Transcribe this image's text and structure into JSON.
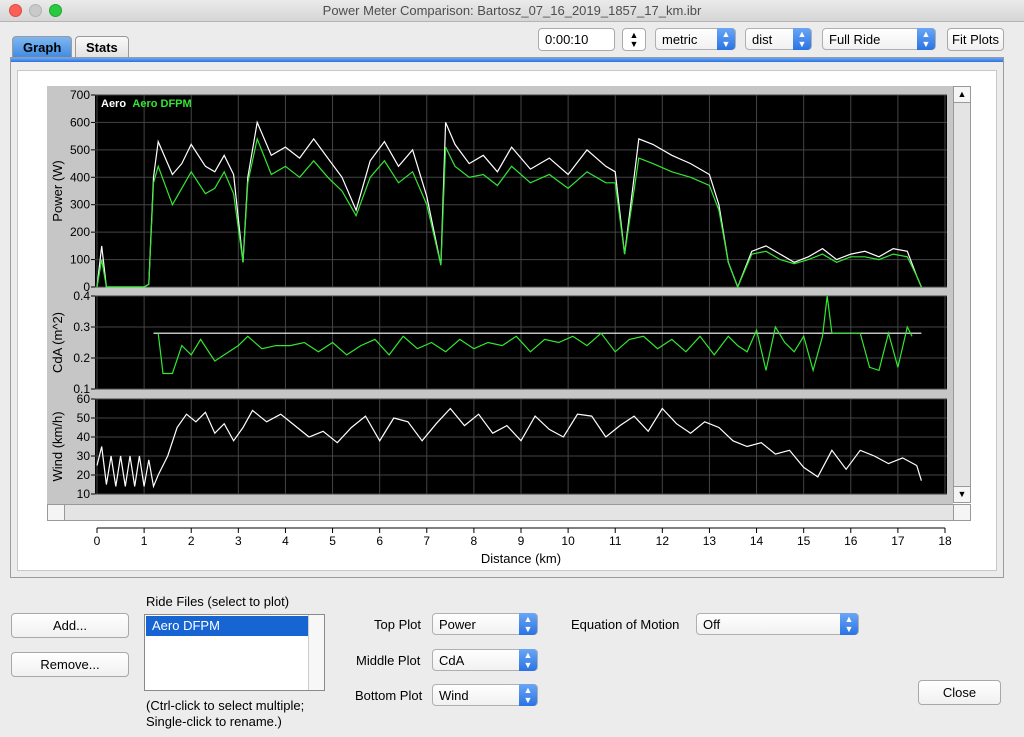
{
  "window": {
    "title": "Power Meter Comparison:  Bartosz_07_16_2019_1857_17_km.ibr"
  },
  "tabs": [
    {
      "label": "Graph"
    },
    {
      "label": "Stats"
    }
  ],
  "toolbar": {
    "time_value": "0:00:10",
    "units": "metric",
    "xaxis": "dist",
    "range": "Full Ride",
    "fit_plots_label": "Fit Plots"
  },
  "chart_data": [
    {
      "type": "line",
      "ylabel": "Power (W)",
      "ylim": [
        0,
        700
      ],
      "yticks": [
        "0",
        "100",
        "200",
        "300",
        "400",
        "500",
        "600",
        "700"
      ],
      "legend": [
        "Aero",
        "Aero DFPM"
      ],
      "legend_placement": "top-left",
      "grid": true,
      "series": [
        {
          "name": "Aero",
          "color": "#ffffff",
          "x": [
            0,
            0.1,
            0.2,
            1.0,
            1.1,
            1.2,
            1.3,
            1.6,
            1.8,
            2.0,
            2.3,
            2.5,
            2.7,
            2.9,
            3.1,
            3.2,
            3.4,
            3.7,
            4.0,
            4.3,
            4.6,
            4.9,
            5.2,
            5.5,
            5.8,
            6.1,
            6.4,
            6.7,
            7.0,
            7.3,
            7.4,
            7.6,
            7.9,
            8.2,
            8.5,
            8.8,
            9.2,
            9.6,
            10.0,
            10.4,
            10.8,
            11.0,
            11.2,
            11.5,
            11.8,
            12.2,
            12.6,
            13.0,
            13.2,
            13.4,
            13.6,
            13.9,
            14.2,
            14.5,
            14.8,
            15.1,
            15.4,
            15.7,
            16.0,
            16.3,
            16.6,
            16.9,
            17.2,
            17.4,
            17.5
          ],
          "y": [
            0,
            150,
            0,
            0,
            10,
            400,
            530,
            410,
            450,
            520,
            440,
            420,
            480,
            410,
            90,
            400,
            600,
            480,
            510,
            470,
            540,
            470,
            400,
            280,
            460,
            530,
            440,
            500,
            330,
            80,
            600,
            520,
            450,
            480,
            420,
            510,
            430,
            470,
            410,
            500,
            440,
            420,
            120,
            540,
            520,
            480,
            450,
            410,
            300,
            90,
            0,
            130,
            150,
            120,
            90,
            110,
            140,
            100,
            120,
            130,
            110,
            140,
            130,
            40,
            0
          ]
        },
        {
          "name": "Aero DFPM",
          "color": "#33e633",
          "x": [
            0,
            0.1,
            0.2,
            1.0,
            1.1,
            1.2,
            1.3,
            1.6,
            1.8,
            2.0,
            2.3,
            2.5,
            2.7,
            2.9,
            3.1,
            3.2,
            3.4,
            3.7,
            4.0,
            4.3,
            4.6,
            4.9,
            5.2,
            5.5,
            5.8,
            6.1,
            6.4,
            6.7,
            7.0,
            7.3,
            7.4,
            7.6,
            7.9,
            8.2,
            8.5,
            8.8,
            9.2,
            9.6,
            10.0,
            10.4,
            10.8,
            11.0,
            11.2,
            11.5,
            11.8,
            12.2,
            12.6,
            13.0,
            13.2,
            13.4,
            13.6,
            13.9,
            14.2,
            14.5,
            14.8,
            15.1,
            15.4,
            15.7,
            16.0,
            16.3,
            16.6,
            16.9,
            17.2,
            17.4,
            17.5
          ],
          "y": [
            0,
            100,
            0,
            0,
            10,
            380,
            440,
            300,
            360,
            420,
            340,
            360,
            420,
            340,
            90,
            380,
            540,
            410,
            440,
            400,
            460,
            400,
            350,
            260,
            400,
            460,
            380,
            420,
            300,
            80,
            510,
            440,
            400,
            410,
            370,
            440,
            380,
            410,
            360,
            420,
            380,
            380,
            120,
            470,
            450,
            420,
            400,
            370,
            280,
            90,
            0,
            120,
            130,
            100,
            85,
            100,
            120,
            90,
            110,
            110,
            100,
            120,
            110,
            40,
            0
          ]
        }
      ]
    },
    {
      "type": "line",
      "ylabel": "CdA (m^2)",
      "ylim": [
        0.1,
        0.4
      ],
      "yticks": [
        "0.1",
        "0.2",
        "0.3",
        "0.4"
      ],
      "grid": true,
      "series": [
        {
          "color": "#ffffff",
          "x": [
            1.2,
            17.5
          ],
          "y": [
            0.28,
            0.28
          ]
        },
        {
          "color": "#33e633",
          "x": [
            1.3,
            1.4,
            1.6,
            1.8,
            2.0,
            2.2,
            2.5,
            2.8,
            3.0,
            3.2,
            3.5,
            3.8,
            4.1,
            4.4,
            4.7,
            5.0,
            5.3,
            5.6,
            5.9,
            6.2,
            6.5,
            6.8,
            7.1,
            7.4,
            7.7,
            8.0,
            8.3,
            8.6,
            8.9,
            9.2,
            9.5,
            9.8,
            10.1,
            10.4,
            10.7,
            11.0,
            11.3,
            11.6,
            11.9,
            12.2,
            12.5,
            12.8,
            13.1,
            13.4,
            13.6,
            13.8,
            14.0,
            14.2,
            14.4,
            14.6,
            14.8,
            15.0,
            15.2,
            15.4,
            15.5,
            15.6,
            15.8,
            16.0,
            16.2,
            16.4,
            16.6,
            16.8,
            17.0,
            17.2,
            17.3
          ],
          "y": [
            0.28,
            0.15,
            0.15,
            0.24,
            0.21,
            0.26,
            0.19,
            0.22,
            0.24,
            0.27,
            0.23,
            0.24,
            0.24,
            0.25,
            0.22,
            0.25,
            0.21,
            0.24,
            0.26,
            0.21,
            0.27,
            0.23,
            0.25,
            0.22,
            0.26,
            0.23,
            0.25,
            0.24,
            0.27,
            0.22,
            0.26,
            0.25,
            0.27,
            0.24,
            0.28,
            0.22,
            0.26,
            0.27,
            0.23,
            0.26,
            0.22,
            0.27,
            0.21,
            0.27,
            0.24,
            0.22,
            0.29,
            0.16,
            0.3,
            0.25,
            0.22,
            0.27,
            0.16,
            0.27,
            0.4,
            0.28,
            0.28,
            0.28,
            0.28,
            0.17,
            0.16,
            0.28,
            0.17,
            0.3,
            0.27
          ]
        }
      ]
    },
    {
      "type": "line",
      "ylabel": "Wind (km/h)",
      "ylim": [
        10,
        60
      ],
      "yticks": [
        "10",
        "20",
        "30",
        "40",
        "50",
        "60"
      ],
      "grid": true,
      "series": [
        {
          "color": "#ffffff",
          "x": [
            0,
            0.1,
            0.2,
            0.3,
            0.4,
            0.5,
            0.6,
            0.7,
            0.8,
            0.9,
            1.0,
            1.1,
            1.2,
            1.3,
            1.5,
            1.7,
            1.9,
            2.1,
            2.3,
            2.5,
            2.7,
            2.9,
            3.1,
            3.3,
            3.6,
            3.9,
            4.2,
            4.5,
            4.8,
            5.1,
            5.4,
            5.7,
            6.0,
            6.3,
            6.6,
            6.9,
            7.2,
            7.5,
            7.8,
            8.1,
            8.4,
            8.7,
            9.0,
            9.3,
            9.6,
            9.9,
            10.2,
            10.5,
            10.8,
            11.1,
            11.4,
            11.7,
            12.0,
            12.3,
            12.6,
            12.9,
            13.2,
            13.5,
            13.8,
            14.1,
            14.4,
            14.7,
            15.0,
            15.3,
            15.6,
            15.9,
            16.2,
            16.5,
            16.8,
            17.1,
            17.4,
            17.5
          ],
          "y": [
            25,
            35,
            15,
            30,
            14,
            30,
            14,
            30,
            14,
            30,
            14,
            28,
            14,
            20,
            30,
            45,
            52,
            48,
            53,
            42,
            47,
            38,
            45,
            54,
            48,
            52,
            46,
            40,
            43,
            37,
            45,
            51,
            38,
            50,
            48,
            38,
            47,
            55,
            46,
            52,
            42,
            46,
            38,
            51,
            44,
            40,
            52,
            51,
            40,
            46,
            51,
            43,
            55,
            47,
            42,
            48,
            45,
            38,
            35,
            37,
            31,
            33,
            24,
            19,
            33,
            23,
            33,
            30,
            26,
            29,
            25,
            17
          ]
        }
      ]
    }
  ],
  "xaxis": {
    "label": "Distance (km)",
    "range": [
      0,
      18
    ],
    "ticks": [
      "0",
      "1",
      "2",
      "3",
      "4",
      "5",
      "6",
      "7",
      "8",
      "9",
      "10",
      "11",
      "12",
      "13",
      "14",
      "15",
      "16",
      "17",
      "18"
    ]
  },
  "bottom": {
    "add_label": "Add...",
    "remove_label": "Remove...",
    "ride_files_label": "Ride Files (select to plot)",
    "ride_files": [
      "Aero DFPM"
    ],
    "hint_line1": "(Ctrl-click to select multiple;",
    "hint_line2": "Single-click to rename.)",
    "top_plot_label": "Top Plot",
    "top_plot_value": "Power",
    "middle_plot_label": "Middle Plot",
    "middle_plot_value": "CdA",
    "bottom_plot_label": "Bottom Plot",
    "bottom_plot_value": "Wind",
    "eom_label": "Equation of Motion",
    "eom_value": "Off",
    "close_label": "Close"
  }
}
